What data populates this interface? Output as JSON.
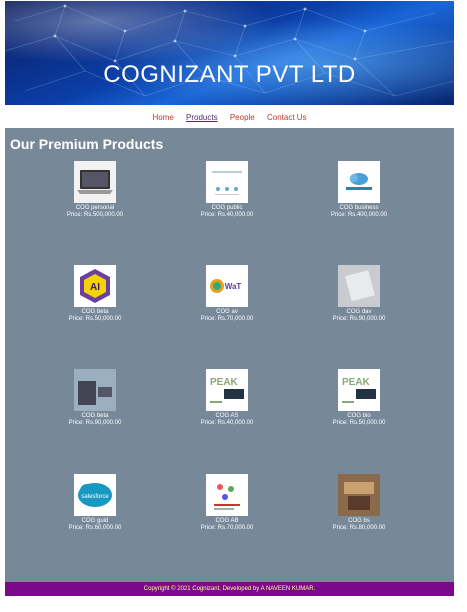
{
  "header": {
    "title": "COGNIZANT PVT LTD"
  },
  "nav": {
    "items": [
      "Home",
      "Products",
      "People",
      "Contact Us"
    ],
    "active": "Products"
  },
  "products": {
    "heading": "Our Premium Products",
    "items": [
      {
        "name": "COG personal",
        "price": "Price: Rs.500,000.00",
        "icon": "laptop-icon"
      },
      {
        "name": "COG public",
        "price": "Price: Rs.40,000.00",
        "icon": "presentation-icon"
      },
      {
        "name": "COG business",
        "price": "Price: Rs.400,000.00",
        "icon": "cloud-logo-icon"
      },
      {
        "name": "COG beta",
        "price": "Price: Rs.50,000.00",
        "icon": "ai-badge-icon"
      },
      {
        "name": "COG av",
        "price": "Price: Rs.70,000.00",
        "icon": "watech-logo-icon"
      },
      {
        "name": "COG dav",
        "price": "Price: Rs.90,000.00",
        "icon": "device-photo-icon"
      },
      {
        "name": "COG beta",
        "price": "Price: Rs.90,000.00",
        "icon": "phone-laptop-icon"
      },
      {
        "name": "COG AS",
        "price": "Price: Rs.40,000.00",
        "icon": "peak-matrix-icon"
      },
      {
        "name": "COG bio",
        "price": "Price: Rs.50,000.00",
        "icon": "peak-matrix-icon"
      },
      {
        "name": "COG guid",
        "price": "Price: Rs.60,000.00",
        "icon": "salesforce-logo-icon"
      },
      {
        "name": "COG AB",
        "price": "Price: Rs.70,000.00",
        "icon": "chart-doc-icon"
      },
      {
        "name": "COG bs",
        "price": "Price: Rs.80,000.00",
        "icon": "office-photo-icon"
      }
    ]
  },
  "footer": {
    "text": "Copyright © 2021 Cognizant, Developed by A NAVEEN KUMAR."
  }
}
